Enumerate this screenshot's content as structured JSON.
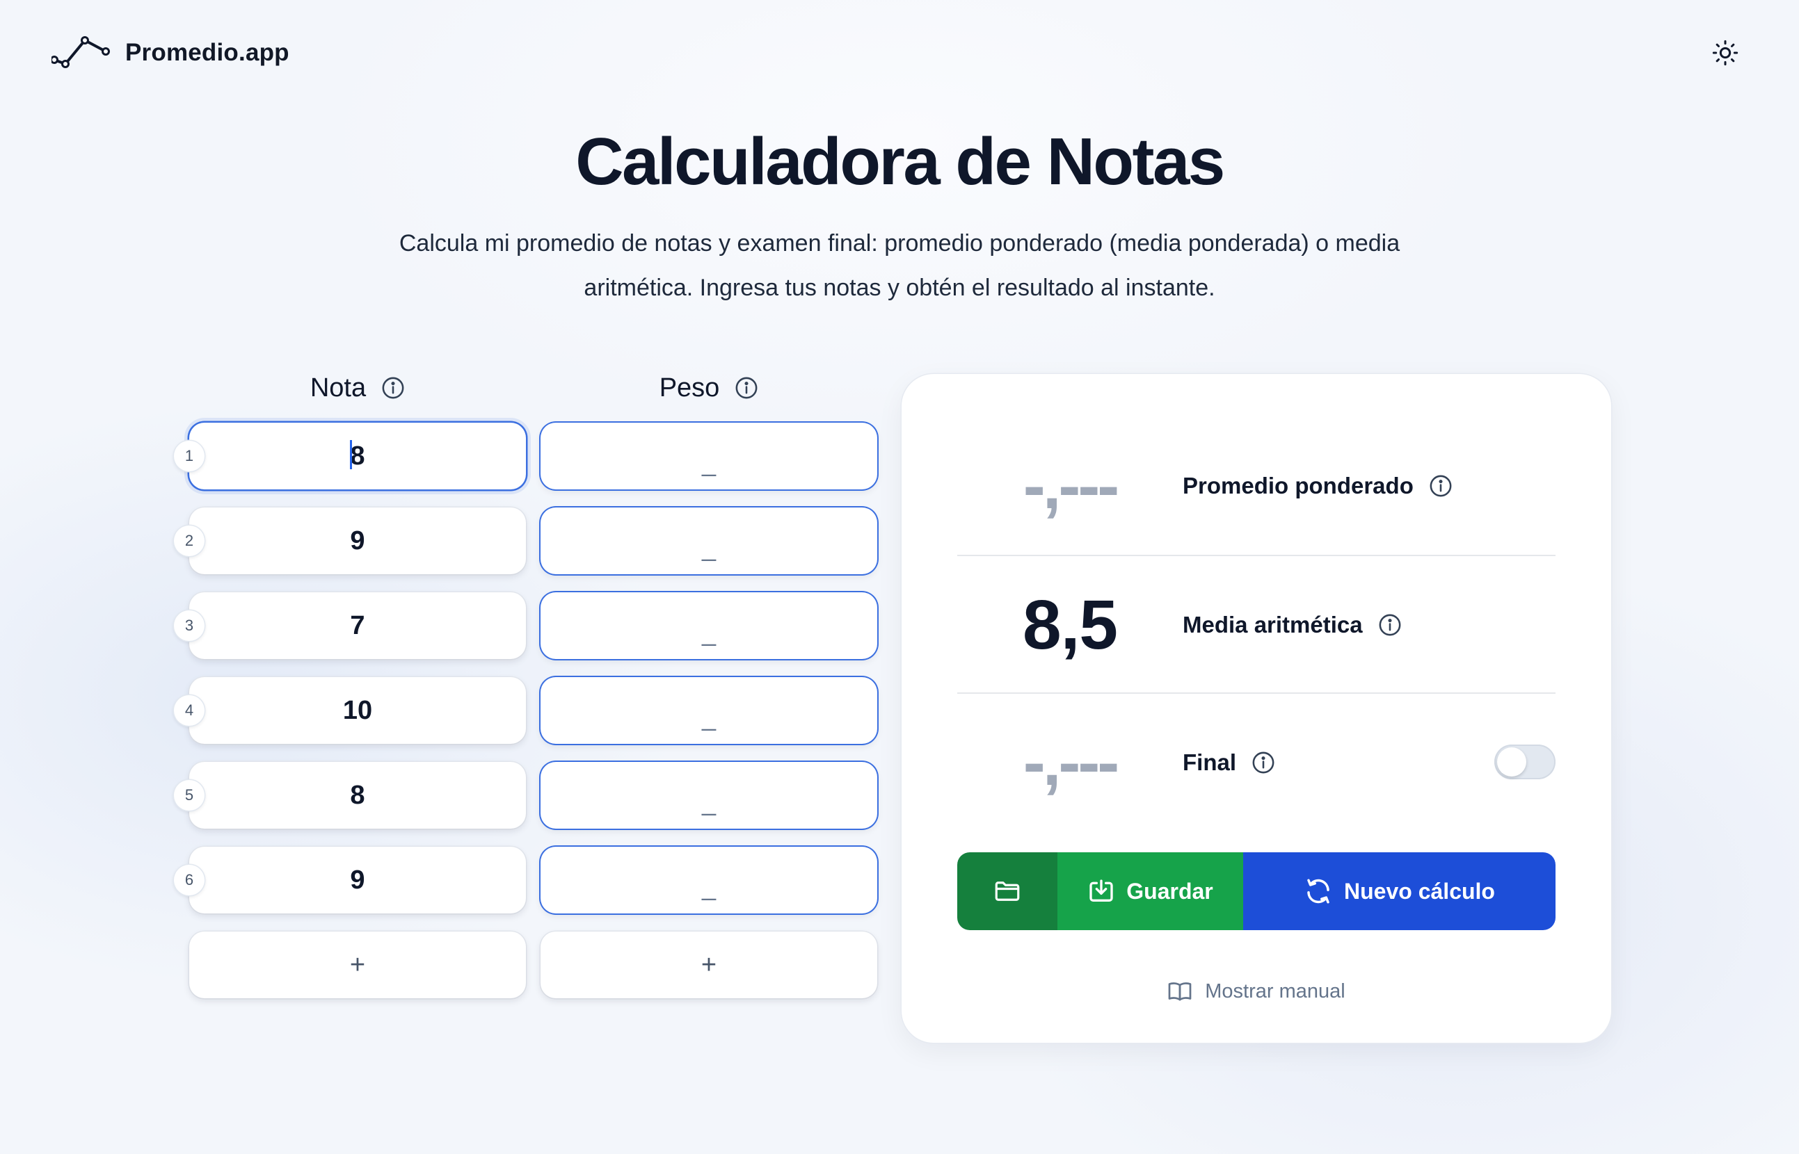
{
  "header": {
    "brand_name": "Promedio.app",
    "logo_icon": "chart-line-icon",
    "theme_icon": "sun-icon"
  },
  "hero": {
    "title": "Calculadora de Notas",
    "subtitle": "Calcula mi promedio de notas y examen final: promedio ponderado (media ponderada) o media aritmética. Ingresa tus notas y obtén el resultado al instante."
  },
  "columns": {
    "nota_label": "Nota",
    "peso_label": "Peso"
  },
  "rows": [
    {
      "num": "1",
      "nota": "8",
      "peso": "_"
    },
    {
      "num": "2",
      "nota": "9",
      "peso": "_"
    },
    {
      "num": "3",
      "nota": "7",
      "peso": "_"
    },
    {
      "num": "4",
      "nota": "10",
      "peso": "_"
    },
    {
      "num": "5",
      "nota": "8",
      "peso": "_"
    },
    {
      "num": "6",
      "nota": "9",
      "peso": "_"
    }
  ],
  "add_label": "+",
  "results": {
    "weighted": {
      "value": "-,---",
      "label": "Promedio ponderado"
    },
    "arithmetic": {
      "value": "8,5",
      "label": "Media aritmética"
    },
    "final": {
      "value": "-,---",
      "label": "Final",
      "toggle_on": false
    }
  },
  "actions": {
    "open_icon": "folder-icon",
    "save_label": "Guardar",
    "new_label": "Nuevo cálculo"
  },
  "manual_label": "Mostrar manual",
  "colors": {
    "primary_blue": "#1d4ed8",
    "save_green": "#16a34a",
    "open_green": "#15803d"
  }
}
